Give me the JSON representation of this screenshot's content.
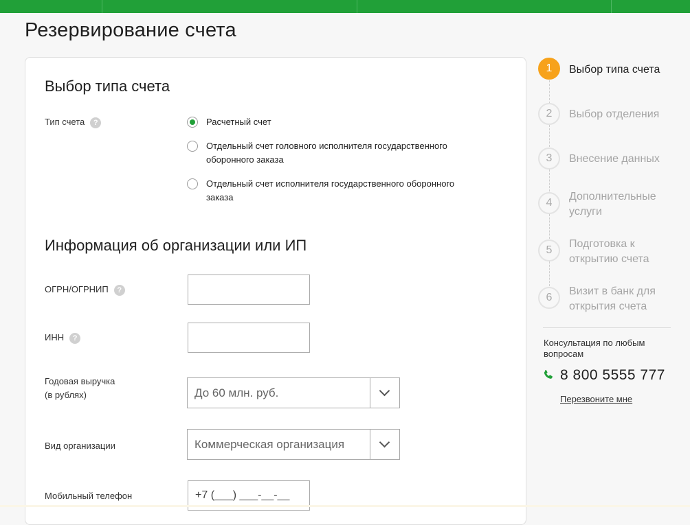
{
  "page": {
    "title": "Резервирование счета"
  },
  "colors": {
    "brand": "#21a038",
    "accent": "#f7a21b"
  },
  "account_type": {
    "title": "Выбор типа счета",
    "label": "Тип счета",
    "help_icon": "question-icon",
    "options": [
      {
        "text": "Расчетный счет",
        "checked": true
      },
      {
        "text": "Отдельный счет головного исполнителя государственного оборонного заказа",
        "line1": "Отдельный счет головного исполнителя государственного",
        "line2": "оборонного заказа",
        "checked": false
      },
      {
        "text": "Отдельный счет исполнителя государственного оборонного заказа",
        "line1": "Отдельный счет исполнителя государственного оборонного",
        "line2": "заказа",
        "checked": false
      }
    ]
  },
  "org_info": {
    "title": "Информация об организации или ИП",
    "ogrn": {
      "label": "ОГРН/ОГРНИП",
      "value": ""
    },
    "inn": {
      "label": "ИНН",
      "value": ""
    },
    "revenue": {
      "label_line1": "Годовая выручка",
      "label_line2": "(в рублях)",
      "value": "До 60 млн. руб."
    },
    "org_type": {
      "label": "Вид организации",
      "value": "Коммерческая организация"
    },
    "mobile": {
      "label": "Мобильный телефон",
      "value": "+7 (___) ___-__-__"
    }
  },
  "steps": [
    {
      "number": "1",
      "label": "Выбор типа счета",
      "active": true
    },
    {
      "number": "2",
      "label": "Выбор отделения",
      "active": false
    },
    {
      "number": "3",
      "label": "Внесение данных",
      "active": false
    },
    {
      "number": "4",
      "label_line1": "Дополнительные",
      "label_line2": "услуги",
      "active": false
    },
    {
      "number": "5",
      "label_line1": "Подготовка к",
      "label_line2": "открытию счета",
      "active": false
    },
    {
      "number": "6",
      "label_line1": "Визит в банк для",
      "label_line2": "открытия счета",
      "active": false
    }
  ],
  "support": {
    "consult_line1": "Консультация по любым",
    "consult_line2": "вопросам",
    "phone_icon": "phone-icon",
    "phone": "8 800 5555 777",
    "callback": "Перезвоните мне"
  }
}
